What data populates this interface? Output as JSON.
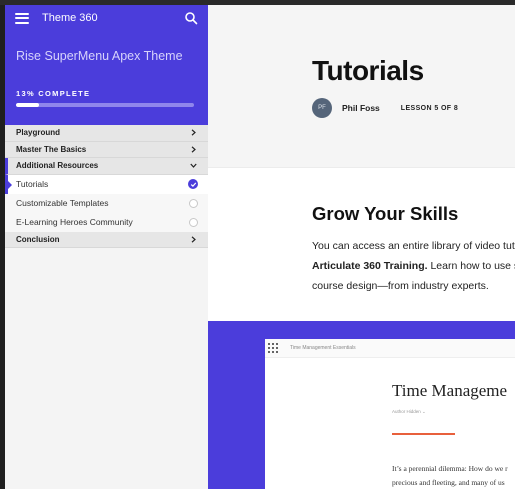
{
  "header": {
    "app_title": "Theme 360",
    "course_title": "Rise SuperMenu Apex Theme",
    "progress_label": "13% COMPLETE",
    "progress_fraction": 0.13,
    "accent_color": "#4b3ddb"
  },
  "menu": {
    "sections": [
      {
        "label": "Playground"
      },
      {
        "label": "Master The Basics"
      },
      {
        "label": "Additional Resources"
      },
      {
        "label": "Conclusion"
      }
    ],
    "lessons": [
      {
        "label": "Tutorials",
        "status": "complete"
      },
      {
        "label": "Customizable Templates",
        "status": "incomplete"
      },
      {
        "label": "E-Learning Heroes Community",
        "status": "incomplete"
      }
    ]
  },
  "lesson": {
    "title": "Tutorials",
    "author_initials": "PF",
    "author": "Phil Foss",
    "count": "LESSON 5 OF 8"
  },
  "content": {
    "heading": "Grow Your Skills",
    "line1": "You can access an entire library of video tuto",
    "line2_bold": "Articulate 360 Training.",
    "line2_rest": " Learn how to use sp",
    "line3": "course design—from industry experts."
  },
  "preview": {
    "course": "Time Management Essentials",
    "title": "Time Manageme",
    "author": "Author Hidden",
    "text1": "It’s a perennial dilemma: How do we r",
    "text2": "precious and fleeting, and many of us"
  }
}
